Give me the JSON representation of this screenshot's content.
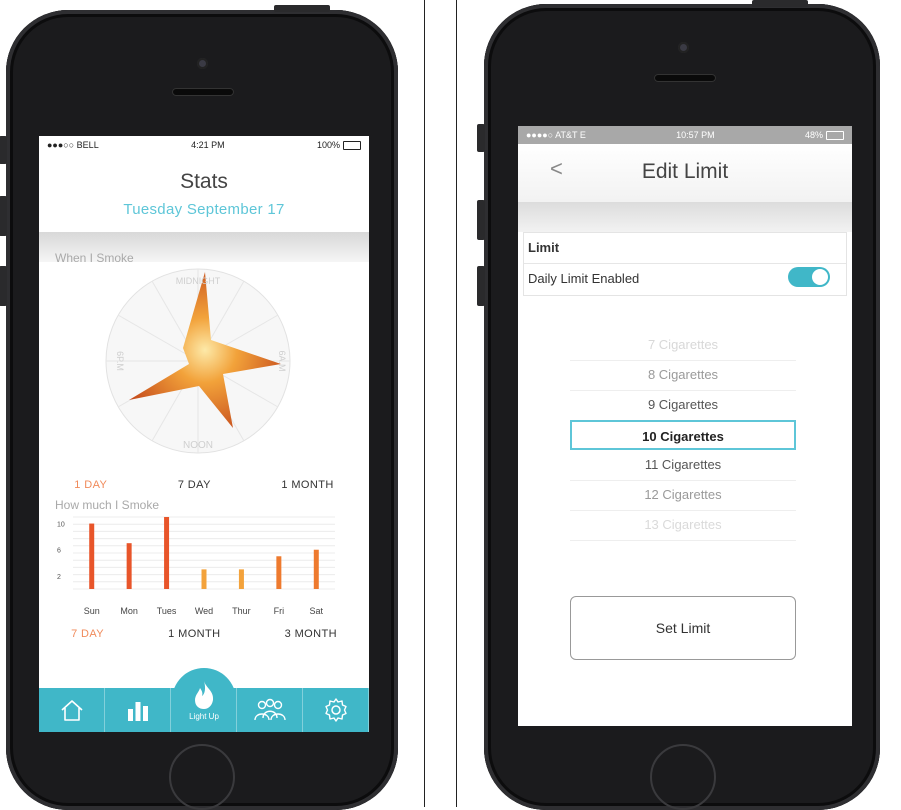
{
  "left_phone": {
    "status": {
      "carrier": "●●●○○ BELL",
      "time": "4:21 PM",
      "battery": "100%"
    },
    "header": {
      "title": "Stats",
      "date": "Tuesday September 17"
    },
    "when_smoke": {
      "label": "When I Smoke",
      "clock_labels": [
        "MIDNIGHT",
        "6A.M",
        "NOON",
        "6P.M"
      ],
      "tabs": [
        "1 DAY",
        "7 DAY",
        "1 MONTH"
      ],
      "active_tab": "1 DAY"
    },
    "how_much": {
      "label": "How much I Smoke",
      "tabs": [
        "7 DAY",
        "1 MONTH",
        "3 MONTH"
      ],
      "active_tab": "7 DAY"
    },
    "tabbar": {
      "items": [
        "home-icon",
        "stats-icon",
        "flame-icon",
        "group-icon",
        "gear-icon"
      ],
      "center_label": "Light Up"
    },
    "colors": {
      "accent": "#40b7c8",
      "active_tab": "#f08a5a",
      "bar": "#e8552a"
    }
  },
  "chart_data": {
    "type": "bar",
    "title": "How much I Smoke",
    "categories": [
      "Sun",
      "Mon",
      "Tues",
      "Wed",
      "Thur",
      "Fri",
      "Sat"
    ],
    "values": [
      10,
      7,
      11,
      3,
      3,
      5,
      6
    ],
    "yticks": [
      "10",
      "6",
      "2"
    ],
    "ylim": [
      0,
      11
    ],
    "grid": true
  },
  "right_phone": {
    "status": {
      "carrier": "●●●●○ AT&T  E",
      "time": "10:57 PM",
      "battery": "48%"
    },
    "header": {
      "title": "Edit Limit",
      "back": "<"
    },
    "limit_section": {
      "heading": "Limit",
      "toggle_label": "Daily Limit Enabled",
      "toggle_on": true
    },
    "picker": {
      "options": [
        "7 Cigarettes",
        "8 Cigarettes",
        "9 Cigarettes",
        "10 Cigarettes",
        "11 Cigarettes",
        "12 Cigarettes",
        "13 Cigarettes"
      ],
      "selected": "10 Cigarettes"
    },
    "set_button": "Set Limit"
  }
}
